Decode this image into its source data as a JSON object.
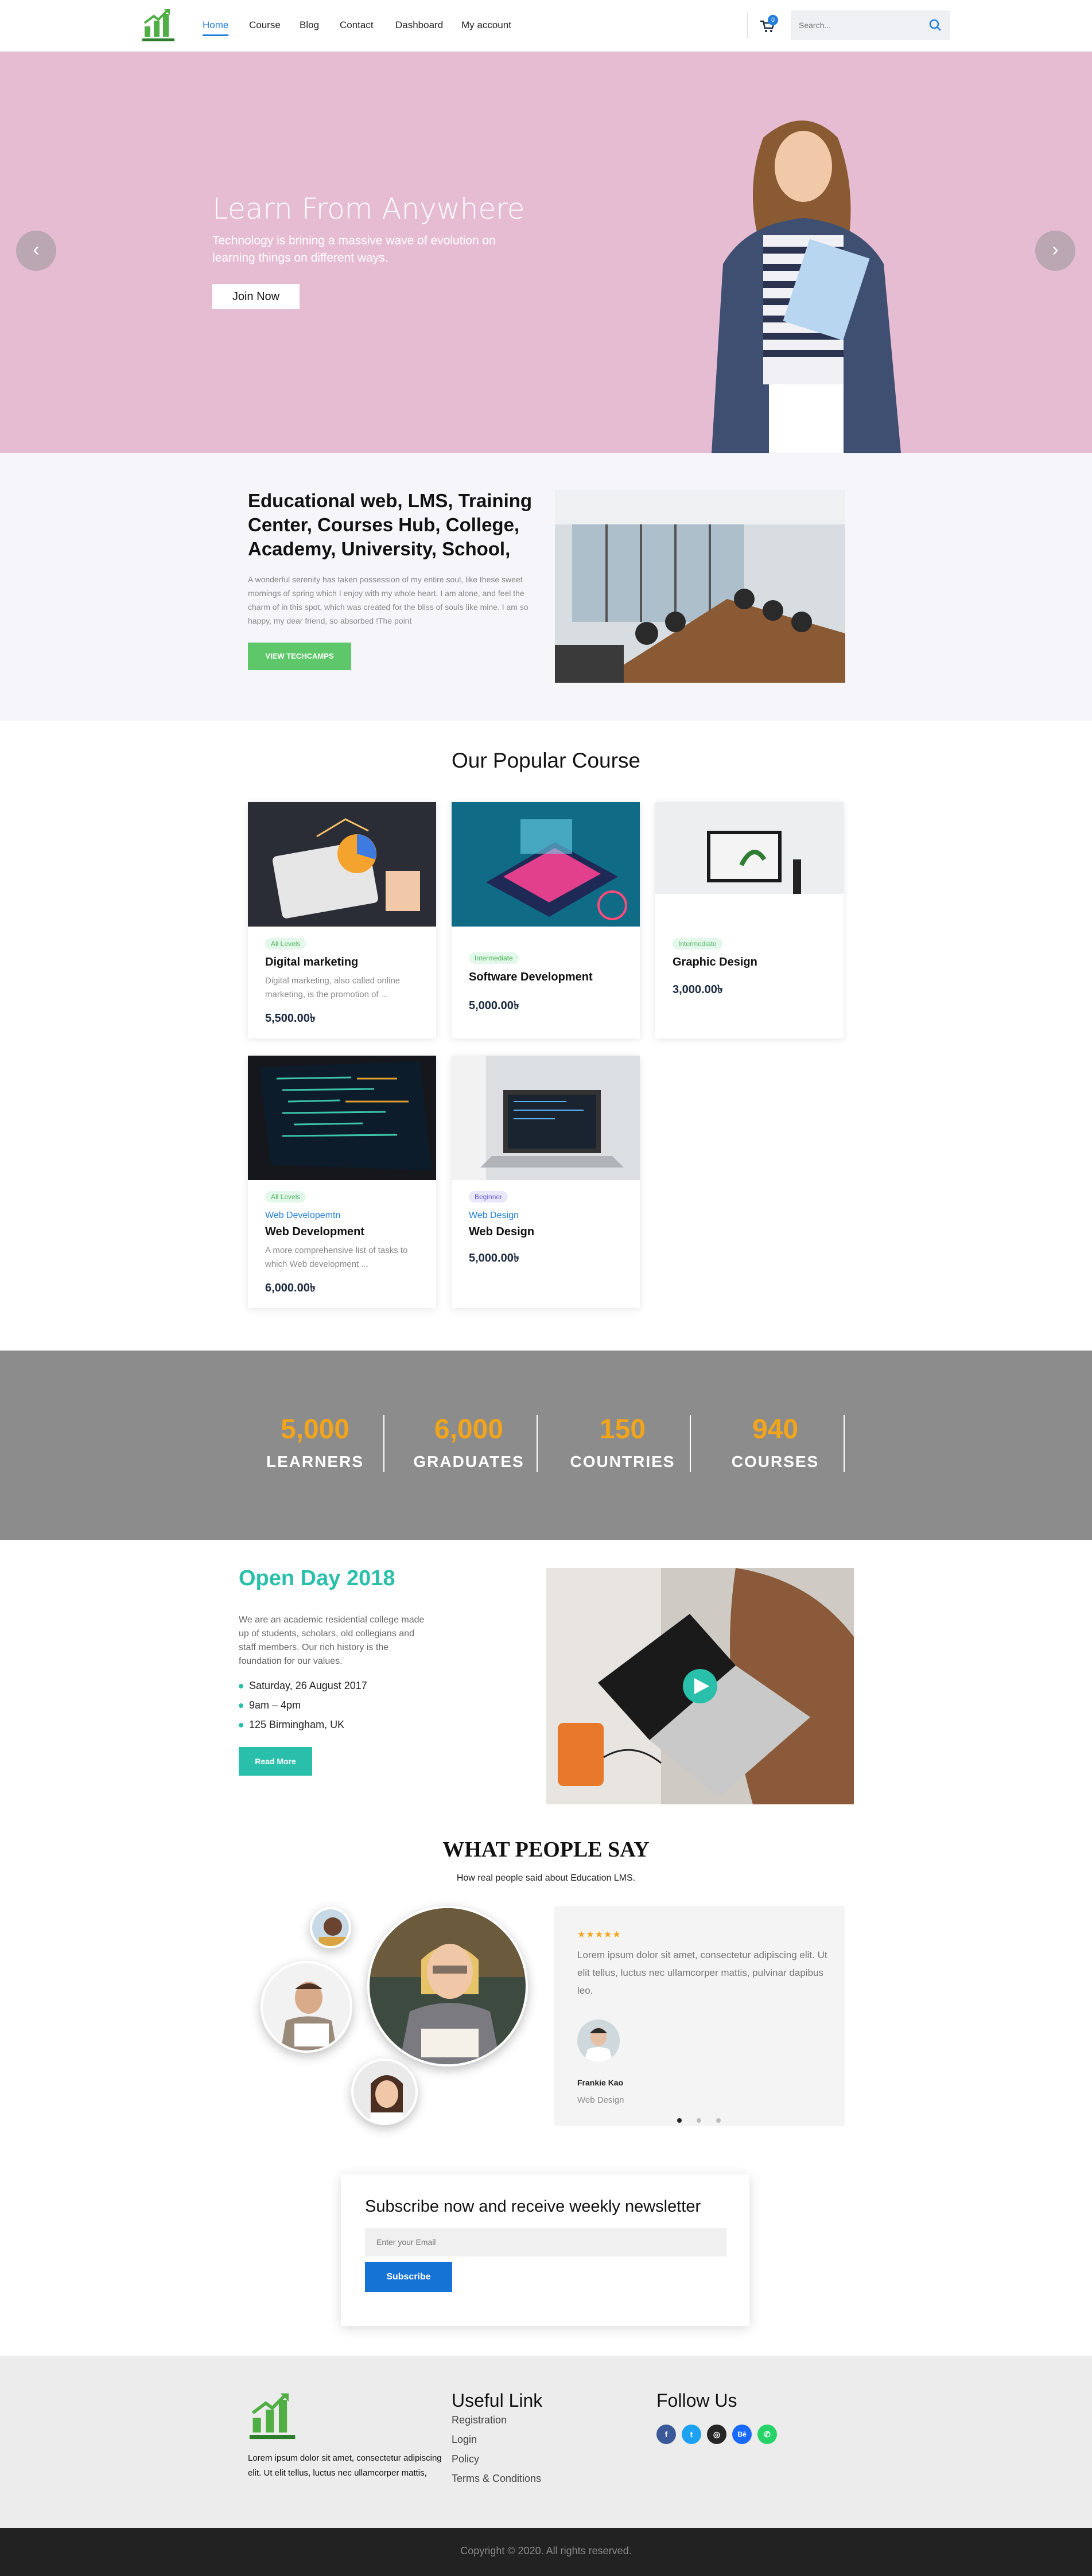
{
  "header": {
    "nav": [
      "Home",
      "Course",
      "Blog",
      "Contact",
      "Dashboard",
      "My account"
    ],
    "cart_count": "0",
    "search_placeholder": "Search..."
  },
  "hero": {
    "title": "Learn From Anywhere",
    "subtitle": "Technology is brining a massive wave of evolution on learning things on different ways.",
    "button": "Join Now",
    "prev_arrow": "‹",
    "next_arrow": "›"
  },
  "about": {
    "title": "Educational web, LMS, Training Center, Courses Hub, College, Academy, University, School,",
    "text": "A wonderful serenity has taken possession of my entire soul, like these sweet mornings of spring which I enjoy with my whole heart. I am alone, and feel the charm of in this spot, which was created for the bliss of souls like mine. I am so happy, my dear friend, so absorbed !The point",
    "button": "VIEW TECHCAMPS"
  },
  "courses": {
    "heading": "Our Popular Course",
    "items": [
      {
        "level": "All Levels",
        "category": "",
        "title": "Digital marketing",
        "desc": "Digital marketing, also called online marketing, is the promotion of ...",
        "price": "5,500.00৳"
      },
      {
        "level": "Intermediate",
        "category": "",
        "title": "Software Development",
        "desc": "",
        "price": "5,000.00৳"
      },
      {
        "level": "Intermediate",
        "category": "",
        "title": "Graphic Design",
        "desc": "",
        "price": "3,000.00৳"
      },
      {
        "level": "All Levels",
        "category": "Web Developemtn",
        "title": "Web Development",
        "desc": "A more comprehensive list of tasks to which Web development ...",
        "price": "6,000.00৳"
      },
      {
        "level": "Beginner",
        "category": "Web Design",
        "title": "Web Design",
        "desc": "",
        "price": "5,000.00৳"
      }
    ]
  },
  "stats": [
    {
      "value": "5,000",
      "label": "LEARNERS"
    },
    {
      "value": "6,000",
      "label": "GRADUATES"
    },
    {
      "value": "150",
      "label": "COUNTRIES"
    },
    {
      "value": "940",
      "label": "COURSES"
    }
  ],
  "openday": {
    "title": "Open Day 2018",
    "text": "We are an academic residential college made up of students, scholars, old collegians and staff members. Our rich history is the foundation for our values.",
    "items": [
      "Saturday, 26 August 2017",
      "9am – 4pm",
      "125 Birmingham, UK"
    ],
    "button": "Read More"
  },
  "testimonials": {
    "heading": "WHAT PEOPLE SAY",
    "subheading": "How real people said about Education LMS.",
    "stars": "★★★★★",
    "quote": "Lorem ipsum dolor sit amet, consectetur adipiscing elit. Ut elit tellus, luctus nec ullamcorper mattis, pulvinar dapibus leo.",
    "name": "Frankie Kao",
    "role": "Web Design"
  },
  "subscribe": {
    "title": "Subscribe now and receive weekly newsletter",
    "placeholder": "Enter your Email",
    "button": "Subscribe"
  },
  "footer": {
    "text": "Lorem ipsum dolor sit amet, consectetur adipiscing elit. Ut elit tellus, luctus nec ullamcorper mattis,",
    "useful_heading": "Useful Link",
    "links": [
      "Registration",
      "Login",
      "Policy",
      "Terms & Conditions"
    ],
    "follow_heading": "Follow Us",
    "social": [
      "f",
      "t",
      "◎",
      "Bē",
      "✆"
    ],
    "copyright": "Copyright © 2020. All rights reserved."
  },
  "colors": {
    "accent": "#1f7ddb",
    "hero_bg": "#e6bcd3",
    "green": "#5ec76a",
    "teal": "#2abfaa",
    "stat_num": "#f2a51a",
    "stats_bg": "#8b8c8b"
  }
}
